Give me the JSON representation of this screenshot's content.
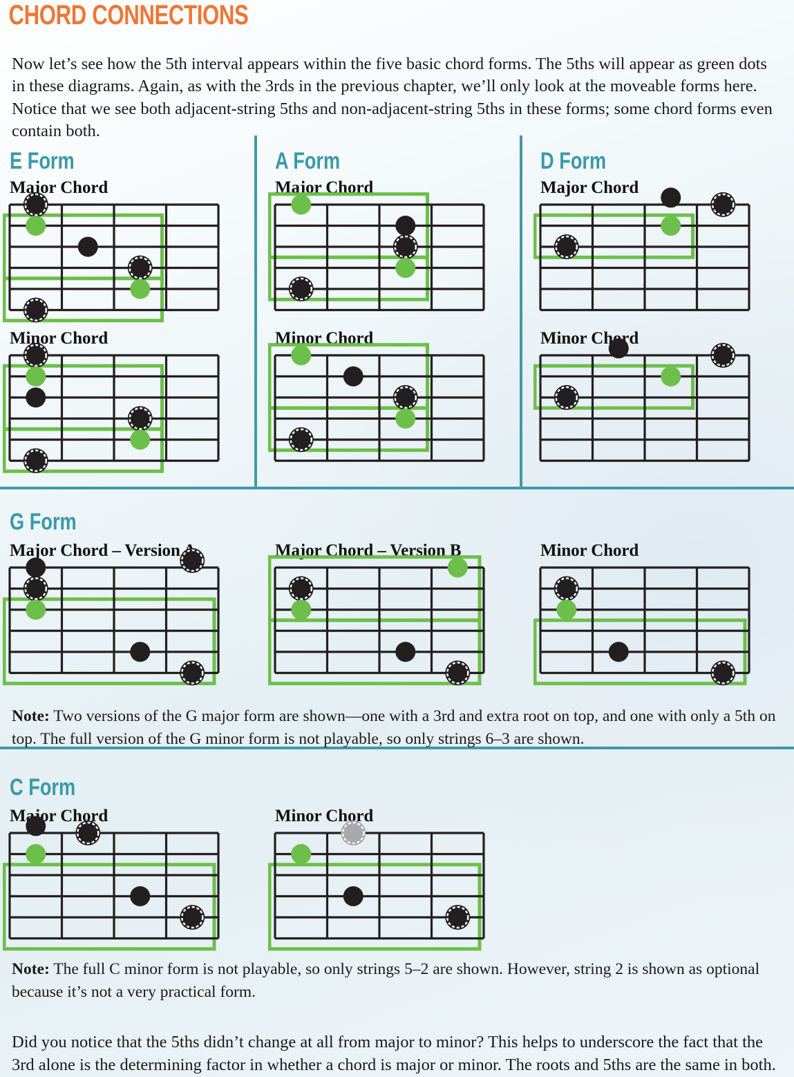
{
  "header": {
    "title": "CHORD CONNECTIONS",
    "title_color": "#ef7634",
    "intro": "Now let’s see how the 5th interval appears within the five basic chord forms. The 5ths will appear as green dots in these diagrams. Again, as with the 3rds in the previous chapter, we’ll only look at the moveable forms here. Notice that we see both adjacent-string 5ths and non-adjacent-string 5ths in these forms; some chord forms even contain both."
  },
  "colors": {
    "accent_orange": "#ef7634",
    "form_teal": "#3a9aa9",
    "divider_teal": "#3f9aa9",
    "fifth_green": "#6cbf4b",
    "box_green": "#6cbf4b",
    "note_black": "#231f20",
    "note_optional_gray": "#a7a9ac",
    "page_bg": "#e6eff4"
  },
  "legend": {
    "green_dot_meaning": "5th",
    "ringed_dot_meaning": "root",
    "gray_dot_meaning": "optional"
  },
  "sections": [
    {
      "id": "row1",
      "forms": [
        {
          "name": "E Form",
          "diagrams": [
            {
              "label": "Major Chord",
              "strings": 6,
              "frets": 4,
              "dots": [
                {
                  "string": 1,
                  "fret": 1,
                  "type": "root"
                },
                {
                  "string": 2,
                  "fret": 1,
                  "type": "fifth"
                },
                {
                  "string": 3,
                  "fret": 2,
                  "type": "plain"
                },
                {
                  "string": 4,
                  "fret": 3,
                  "type": "root"
                },
                {
                  "string": 5,
                  "fret": 3,
                  "type": "fifth"
                },
                {
                  "string": 6,
                  "fret": 1,
                  "type": "root"
                }
              ],
              "boxes": [
                {
                  "s1": 1,
                  "s2": 4,
                  "f1": 1,
                  "f2": 3
                },
                {
                  "s1": 4,
                  "s2": 6,
                  "f1": 1,
                  "f2": 3
                }
              ]
            },
            {
              "label": "Minor Chord",
              "strings": 6,
              "frets": 4,
              "dots": [
                {
                  "string": 1,
                  "fret": 1,
                  "type": "root"
                },
                {
                  "string": 2,
                  "fret": 1,
                  "type": "fifth"
                },
                {
                  "string": 3,
                  "fret": 1,
                  "type": "plain"
                },
                {
                  "string": 4,
                  "fret": 3,
                  "type": "root"
                },
                {
                  "string": 5,
                  "fret": 3,
                  "type": "fifth"
                },
                {
                  "string": 6,
                  "fret": 1,
                  "type": "root"
                }
              ],
              "boxes": [
                {
                  "s1": 1,
                  "s2": 4,
                  "f1": 1,
                  "f2": 3
                },
                {
                  "s1": 4,
                  "s2": 6,
                  "f1": 1,
                  "f2": 3
                }
              ]
            }
          ]
        },
        {
          "name": "A Form",
          "diagrams": [
            {
              "label": "Major Chord",
              "strings": 6,
              "frets": 4,
              "dots": [
                {
                  "string": 1,
                  "fret": 1,
                  "type": "fifth"
                },
                {
                  "string": 2,
                  "fret": 3,
                  "type": "plain"
                },
                {
                  "string": 3,
                  "fret": 3,
                  "type": "root"
                },
                {
                  "string": 4,
                  "fret": 3,
                  "type": "fifth"
                },
                {
                  "string": 5,
                  "fret": 1,
                  "type": "root"
                }
              ],
              "boxes": [
                {
                  "s1": 0,
                  "s2": 3,
                  "f1": 1,
                  "f2": 3
                },
                {
                  "s1": 3,
                  "s2": 5,
                  "f1": 1,
                  "f2": 3
                }
              ]
            },
            {
              "label": "Minor Chord",
              "strings": 6,
              "frets": 4,
              "dots": [
                {
                  "string": 1,
                  "fret": 1,
                  "type": "fifth"
                },
                {
                  "string": 2,
                  "fret": 2,
                  "type": "plain"
                },
                {
                  "string": 3,
                  "fret": 3,
                  "type": "root"
                },
                {
                  "string": 4,
                  "fret": 3,
                  "type": "fifth"
                },
                {
                  "string": 5,
                  "fret": 1,
                  "type": "root"
                }
              ],
              "boxes": [
                {
                  "s1": 0,
                  "s2": 3,
                  "f1": 1,
                  "f2": 3
                },
                {
                  "s1": 3,
                  "s2": 5,
                  "f1": 1,
                  "f2": 3
                }
              ]
            }
          ]
        },
        {
          "name": "D Form",
          "diagrams": [
            {
              "label": "Major Chord",
              "strings": 6,
              "frets": 4,
              "dots": [
                {
                  "string": 0,
                  "fret": 3,
                  "type": "plain"
                },
                {
                  "string": 1,
                  "fret": 4,
                  "type": "root"
                },
                {
                  "string": 2,
                  "fret": 3,
                  "type": "fifth"
                },
                {
                  "string": 3,
                  "fret": 1,
                  "type": "root"
                }
              ],
              "boxes": [
                {
                  "s1": 1,
                  "s2": 3,
                  "f1": 1,
                  "f2": 3
                }
              ]
            },
            {
              "label": "Minor Chord",
              "strings": 6,
              "frets": 4,
              "dots": [
                {
                  "string": 0,
                  "fret": 2,
                  "type": "plain"
                },
                {
                  "string": 1,
                  "fret": 4,
                  "type": "root"
                },
                {
                  "string": 2,
                  "fret": 3,
                  "type": "fifth"
                },
                {
                  "string": 3,
                  "fret": 1,
                  "type": "root"
                }
              ],
              "boxes": [
                {
                  "s1": 1,
                  "s2": 3,
                  "f1": 1,
                  "f2": 3
                }
              ]
            }
          ]
        }
      ]
    },
    {
      "id": "row2",
      "forms": [
        {
          "name": "G Form",
          "diagrams": [
            {
              "label": "Major Chord – Version A",
              "strings": 6,
              "frets": 4,
              "dots": [
                {
                  "string": 0,
                  "fret": 4,
                  "type": "root"
                },
                {
                  "string": 1,
                  "fret": 1,
                  "type": "plain"
                },
                {
                  "string": 2,
                  "fret": 1,
                  "type": "root"
                },
                {
                  "string": 3,
                  "fret": 1,
                  "type": "fifth"
                },
                {
                  "string": 5,
                  "fret": 3,
                  "type": "plain"
                },
                {
                  "string": 6,
                  "fret": 4,
                  "type": "root"
                }
              ],
              "boxes": [
                {
                  "s1": 2,
                  "s2": 6,
                  "f1": 1,
                  "f2": 4
                }
              ]
            },
            {
              "label": "Major Chord – Version B",
              "strings": 6,
              "frets": 4,
              "dots": [
                {
                  "string": 1,
                  "fret": 4,
                  "type": "fifth"
                },
                {
                  "string": 2,
                  "fret": 1,
                  "type": "root"
                },
                {
                  "string": 3,
                  "fret": 1,
                  "type": "fifth"
                },
                {
                  "string": 5,
                  "fret": 3,
                  "type": "plain"
                },
                {
                  "string": 6,
                  "fret": 4,
                  "type": "root"
                }
              ],
              "boxes": [
                {
                  "s1": 0,
                  "s2": 3,
                  "f1": 1,
                  "f2": 4
                },
                {
                  "s1": 3,
                  "s2": 6,
                  "f1": 1,
                  "f2": 4
                }
              ]
            },
            {
              "label": "Minor Chord",
              "strings": 6,
              "frets": 4,
              "dots": [
                {
                  "string": 2,
                  "fret": 1,
                  "type": "root"
                },
                {
                  "string": 3,
                  "fret": 1,
                  "type": "fifth"
                },
                {
                  "string": 5,
                  "fret": 2,
                  "type": "plain"
                },
                {
                  "string": 6,
                  "fret": 4,
                  "type": "root"
                }
              ],
              "boxes": [
                {
                  "s1": 3,
                  "s2": 6,
                  "f1": 1,
                  "f2": 4
                }
              ]
            }
          ]
        }
      ],
      "note": {
        "label": "Note:",
        "text": " Two versions of the G major form are shown—one with a 3rd and extra root on top, and one with only a 5th on top. The full version of the G minor form is not playable, so only strings 6–3 are shown."
      }
    },
    {
      "id": "row3",
      "forms": [
        {
          "name": "C Form",
          "diagrams": [
            {
              "label": "Major Chord",
              "strings": 6,
              "frets": 4,
              "dots": [
                {
                  "string": 0,
                  "fret": 1,
                  "type": "plain"
                },
                {
                  "string": 1,
                  "fret": 2,
                  "type": "root"
                },
                {
                  "string": 2,
                  "fret": 1,
                  "type": "fifth"
                },
                {
                  "string": 4,
                  "fret": 3,
                  "type": "plain"
                },
                {
                  "string": 5,
                  "fret": 4,
                  "type": "root"
                }
              ],
              "boxes": [
                {
                  "s1": 2,
                  "s2": 6,
                  "f1": 1,
                  "f2": 4
                }
              ]
            },
            {
              "label": "Minor Chord",
              "strings": 6,
              "frets": 4,
              "dots": [
                {
                  "string": 1,
                  "fret": 2,
                  "type": "optional"
                },
                {
                  "string": 2,
                  "fret": 1,
                  "type": "fifth"
                },
                {
                  "string": 4,
                  "fret": 2,
                  "type": "plain"
                },
                {
                  "string": 5,
                  "fret": 4,
                  "type": "root"
                }
              ],
              "boxes": [
                {
                  "s1": 2,
                  "s2": 6,
                  "f1": 1,
                  "f2": 4
                }
              ]
            }
          ]
        }
      ],
      "note": {
        "label": "Note:",
        "text": " The full C minor form is not playable, so only strings 5–2 are shown. However, string 2 is shown as optional because it’s not a very practical form."
      }
    }
  ],
  "closing": "Did you notice that the 5ths didn’t change at all from major to minor? This helps to underscore the fact that the 3rd alone is the determining factor in whether a chord is major or minor. The roots and 5ths are the same in both."
}
